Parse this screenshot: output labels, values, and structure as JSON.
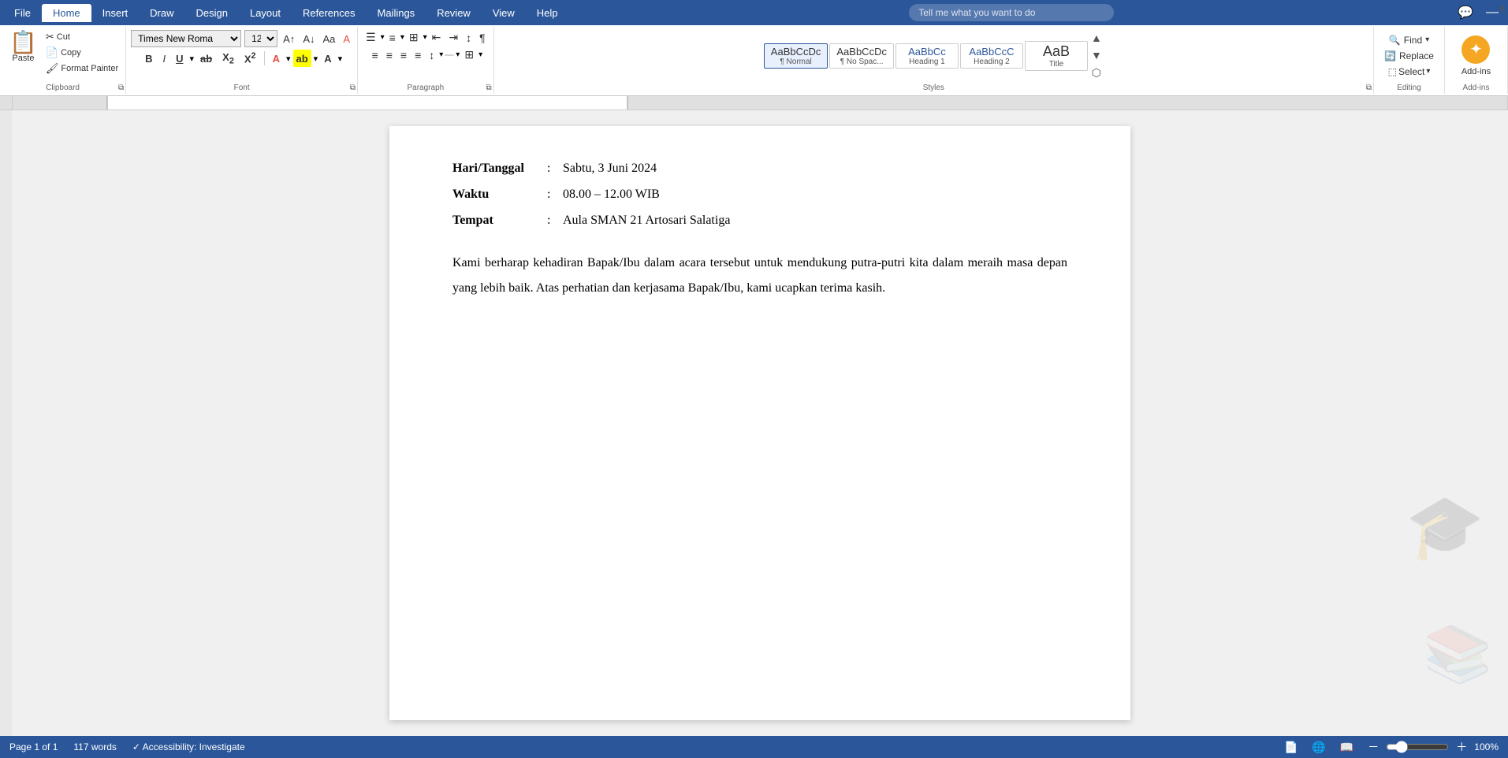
{
  "tabs": {
    "items": [
      "File",
      "Home",
      "Insert",
      "Draw",
      "Design",
      "Layout",
      "References",
      "Mailings",
      "Review",
      "View",
      "Help"
    ],
    "active": "Home"
  },
  "search": {
    "placeholder": "Tell me what you want to do"
  },
  "clipboard": {
    "paste_label": "Paste",
    "cut_label": "Cut",
    "copy_label": "Copy",
    "format_painter_label": "Format Painter",
    "group_label": "Clipboard"
  },
  "font": {
    "name": "Times New Roma",
    "size": "12",
    "group_label": "Font",
    "bold_label": "B",
    "italic_label": "I",
    "underline_label": "U"
  },
  "paragraph": {
    "group_label": "Paragraph"
  },
  "styles": {
    "group_label": "Styles",
    "items": [
      {
        "preview": "AaBbCcDc",
        "label": "¶ Normal",
        "active": true
      },
      {
        "preview": "AaBbCcDc",
        "label": "¶ No Spac...",
        "active": false
      },
      {
        "preview": "AaBbCc",
        "label": "Heading 1",
        "active": false
      },
      {
        "preview": "AaBbCcC",
        "label": "Heading 2",
        "active": false
      },
      {
        "preview": "AaB",
        "label": "Title",
        "active": false
      }
    ]
  },
  "editing": {
    "group_label": "Editing",
    "find_label": "Find",
    "replace_label": "Replace",
    "select_label": "Select"
  },
  "addins": {
    "group_label": "Add-ins",
    "label": "Add-ins"
  },
  "document": {
    "info_rows": [
      {
        "label": "Hari/Tanggal",
        "sep": ":",
        "value": "Sabtu, 3 Juni 2024"
      },
      {
        "label": "Waktu",
        "sep": ":",
        "value": "08.00 – 12.00 WIB"
      },
      {
        "label": "Tempat",
        "sep": ":",
        "value": "Aula SMAN 21 Artosari Salatiga"
      }
    ],
    "paragraph": "Kami berharap kehadiran Bapak/Ibu dalam acara tersebut untuk mendukung putra-putri kita dalam meraih masa depan yang lebih baik. Atas perhatian dan kerjasama Bapak/Ibu, kami ucapkan terima kasih."
  },
  "statusbar": {
    "page_info": "Page 1 of 1",
    "words": "117 words",
    "accessibility": "Accessibility: Investigate",
    "zoom": "100%"
  }
}
